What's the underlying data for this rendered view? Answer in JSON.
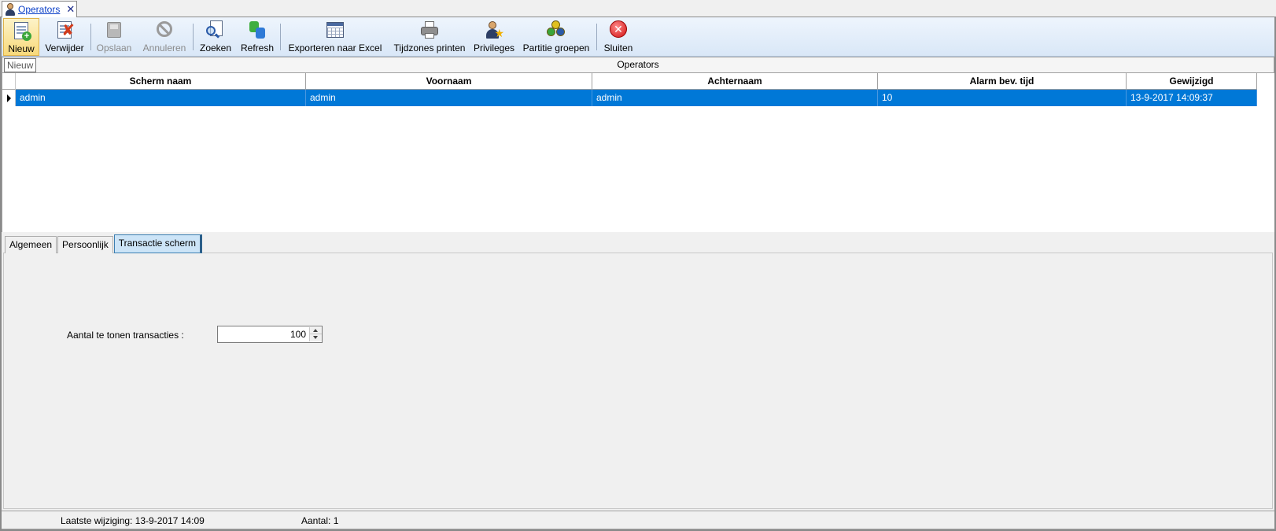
{
  "document_tab": {
    "label": "Operators",
    "close": "✕",
    "icon": "user-icon"
  },
  "toolbar": {
    "buttons": [
      {
        "label": "Nieuw",
        "icon": "new-document-icon",
        "state": "hover"
      },
      {
        "label": "Verwijder",
        "icon": "delete-document-icon",
        "state": "enabled"
      },
      {
        "label": "Opslaan",
        "icon": "save-icon",
        "state": "disabled"
      },
      {
        "label": "Annuleren",
        "icon": "cancel-icon",
        "state": "disabled"
      },
      {
        "label": "Zoeken",
        "icon": "search-icon",
        "state": "enabled"
      },
      {
        "label": "Refresh",
        "icon": "refresh-icon",
        "state": "enabled"
      },
      {
        "label": "Exporteren naar Excel",
        "icon": "spreadsheet-icon",
        "state": "enabled"
      },
      {
        "label": "Tijdzones printen",
        "icon": "printer-icon",
        "state": "enabled"
      },
      {
        "label": "Privileges",
        "icon": "user-star-icon",
        "state": "enabled"
      },
      {
        "label": "Partitie groepen",
        "icon": "group-icon",
        "state": "enabled"
      },
      {
        "label": "Sluiten",
        "icon": "close-red-icon",
        "state": "enabled"
      }
    ]
  },
  "tooltip": {
    "text": "Nieuw"
  },
  "grid": {
    "caption": "Operators",
    "columns": [
      "Scherm naam",
      "Voornaam",
      "Achternaam",
      "Alarm bev. tijd",
      "Gewijzigd"
    ],
    "rows": [
      {
        "selected": true,
        "cells": [
          "admin",
          "admin",
          "admin",
          "10",
          "13-9-2017 14:09:37"
        ]
      }
    ]
  },
  "detail_tabs": {
    "tabs": [
      {
        "label": "Algemeen",
        "active": false
      },
      {
        "label": "Persoonlijk",
        "active": false
      },
      {
        "label": "Transactie scherm",
        "active": true
      }
    ]
  },
  "transactie": {
    "label": "Aantal te tonen transacties :",
    "value": "100"
  },
  "status": {
    "last_change": "Laatste wijziging: 13-9-2017 14:09",
    "count": "Aantal: 1"
  },
  "colors": {
    "selection": "#0078d7",
    "toolbar_hover": "#f8d97a",
    "active_tab": "#cce4f7"
  }
}
